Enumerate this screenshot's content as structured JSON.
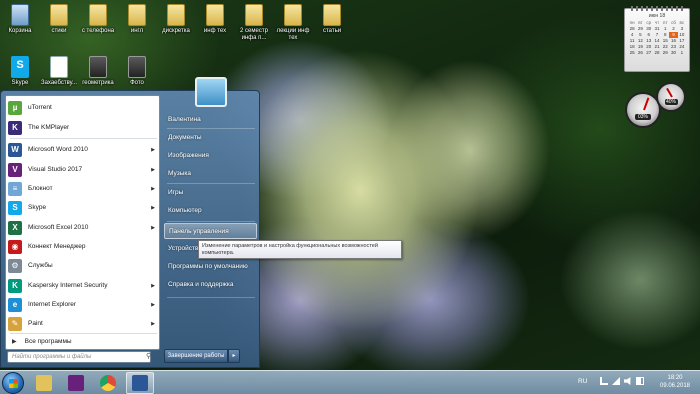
{
  "desktop": {
    "icons_row1": [
      {
        "label": "Корзина",
        "type": "bin"
      },
      {
        "label": "стики",
        "type": "folder"
      },
      {
        "label": "с телефона",
        "type": "folder"
      },
      {
        "label": "ингл",
        "type": "folder"
      },
      {
        "label": "дискретка",
        "type": "folder"
      },
      {
        "label": "инф тех",
        "type": "folder"
      },
      {
        "label": "2 семестр инфа п...",
        "type": "folder"
      },
      {
        "label": "лекции инф тех",
        "type": "folder"
      },
      {
        "label": "статьи",
        "type": "folder"
      }
    ],
    "icons_row2": [
      {
        "label": "Skype",
        "type": "skype"
      },
      {
        "label": "Захаебству...",
        "type": "doc"
      },
      {
        "label": "геометрика",
        "type": "folder-img"
      },
      {
        "label": "Фото",
        "type": "folder-img"
      }
    ]
  },
  "calendar": {
    "month": "июн 18",
    "weekdays": [
      "пн",
      "вт",
      "ср",
      "чт",
      "пт",
      "сб",
      "вс"
    ],
    "days": [
      "28",
      "29",
      "30",
      "31",
      "1",
      "2",
      "3",
      "4",
      "5",
      "6",
      "7",
      "8",
      "9",
      "10",
      "11",
      "12",
      "13",
      "14",
      "15",
      "16",
      "17",
      "18",
      "19",
      "20",
      "21",
      "22",
      "23",
      "24",
      "25",
      "26",
      "27",
      "28",
      "29",
      "30",
      "1"
    ],
    "today": "9"
  },
  "gauges": {
    "cpu": "03%",
    "ram": "40%"
  },
  "start_menu": {
    "programs": [
      {
        "label": "uTorrent",
        "icon": "utorrent-icon",
        "color": "#5aa63c",
        "glyph": "µ",
        "arrow": false
      },
      {
        "label": "The KMPlayer",
        "icon": "kmplayer-icon",
        "color": "#3b2a78",
        "glyph": "K",
        "arrow": false
      },
      {
        "label": "Microsoft Word 2010",
        "icon": "word-icon",
        "color": "#2b5797",
        "glyph": "W",
        "arrow": true
      },
      {
        "label": "Visual Studio 2017",
        "icon": "visual-studio-icon",
        "color": "#68217a",
        "glyph": "V",
        "arrow": true
      },
      {
        "label": "Блокнот",
        "icon": "notepad-icon",
        "color": "#6fa8d6",
        "glyph": "≡",
        "arrow": true
      },
      {
        "label": "Skype",
        "icon": "skype-icon",
        "color": "#12a9ea",
        "glyph": "S",
        "arrow": true
      },
      {
        "label": "Microsoft Excel 2010",
        "icon": "excel-icon",
        "color": "#1e7145",
        "glyph": "X",
        "arrow": true
      },
      {
        "label": "Коннект Менеджер",
        "icon": "connect-manager-icon",
        "color": "#c41a1a",
        "glyph": "◉",
        "arrow": false
      },
      {
        "label": "Службы",
        "icon": "services-icon",
        "color": "#7d8a96",
        "glyph": "⚙",
        "arrow": false
      },
      {
        "label": "Kaspersky Internet Security",
        "icon": "kaspersky-icon",
        "color": "#009b7d",
        "glyph": "K",
        "arrow": true
      },
      {
        "label": "Internet Explorer",
        "icon": "internet-explorer-icon",
        "color": "#1c8fd6",
        "glyph": "e",
        "arrow": true
      },
      {
        "label": "Paint",
        "icon": "paint-icon",
        "color": "#d6a23c",
        "glyph": "✎",
        "arrow": true
      }
    ],
    "all_programs": "Все программы",
    "search_placeholder": "Найти программы и файлы",
    "right_items": [
      "Валентина",
      "Документы",
      "Изображения",
      "Музыка",
      "Игры",
      "Компьютер",
      "Панель управления",
      "Устройства и принтеры",
      "Программы по умолчанию",
      "Справка и поддержка"
    ],
    "highlighted_item": "Панель управления",
    "shutdown_label": "Завершение работы",
    "shutdown_arrow": "▸"
  },
  "tooltip": {
    "text": "Изменение параметров и настройка функциональных возможностей компьютера."
  },
  "taskbar": {
    "pinned": [
      {
        "name": "explorer-icon",
        "color": "#e2c25a"
      },
      {
        "name": "visual-studio-icon",
        "color": "#68217a"
      },
      {
        "name": "chrome-icon",
        "color": "#dd4b39"
      },
      {
        "name": "word-icon",
        "color": "#2b5797"
      }
    ],
    "language": "RU",
    "time": "18:20",
    "date": "09.06.2018"
  }
}
